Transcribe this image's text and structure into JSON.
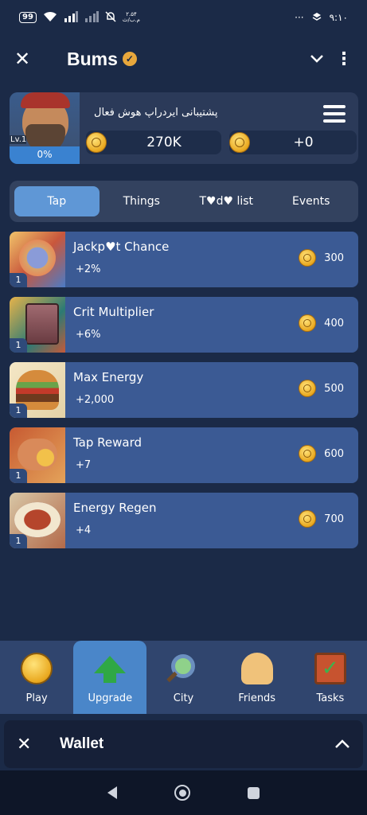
{
  "status_bar": {
    "battery": "99",
    "net_speed_top": "۲.۵۴",
    "net_speed_bottom": "م.ب/ث",
    "time": "۹:۱۰",
    "more": "···"
  },
  "app_bar": {
    "title": "Bums",
    "close_icon": "✕",
    "chevron_icon": "⌄",
    "more_icon": "⋮"
  },
  "profile": {
    "level": "Lv.1",
    "progress_text": "0%",
    "progress_value": 0,
    "airdrop_support": "پشتیبانی ایردراپ هوش فعال",
    "balance": "270K",
    "per_tap": "+0"
  },
  "tabs": [
    "Tap",
    "Things",
    "T♥d♥ list",
    "Events"
  ],
  "active_tab": 0,
  "upgrades": [
    {
      "name": "Jackp♥t Chance",
      "bonus": "+2%",
      "price": "300",
      "level": "1",
      "icon": "stopwatch-icon"
    },
    {
      "name": "Crit Multiplier",
      "bonus": "+6%",
      "price": "400",
      "level": "1",
      "icon": "safe-icon"
    },
    {
      "name": "Max Energy",
      "bonus": "+2,000",
      "price": "500",
      "level": "1",
      "icon": "burger-icon"
    },
    {
      "name": "Tap Reward",
      "bonus": "+7",
      "price": "600",
      "level": "1",
      "icon": "coin-hand-icon"
    },
    {
      "name": "Energy Regen",
      "bonus": "+4",
      "price": "700",
      "level": "1",
      "icon": "steak-plate-icon"
    }
  ],
  "bottom_nav": [
    {
      "label": "Play",
      "icon": "coin-icon"
    },
    {
      "label": "Upgrade",
      "icon": "arrow-up-icon"
    },
    {
      "label": "City",
      "icon": "magnifier-icon"
    },
    {
      "label": "Friends",
      "icon": "friends-icon"
    },
    {
      "label": "Tasks",
      "icon": "checklist-icon"
    }
  ],
  "active_nav": 1,
  "wallet": {
    "label": "Wallet",
    "close_icon": "✕",
    "expand_icon": "︿"
  },
  "colors": {
    "background": "#1b2a47",
    "card": "#3b5a94",
    "active_tab": "#5f97d6",
    "active_nav": "#4a86c9",
    "coin": "#e9a81f"
  }
}
